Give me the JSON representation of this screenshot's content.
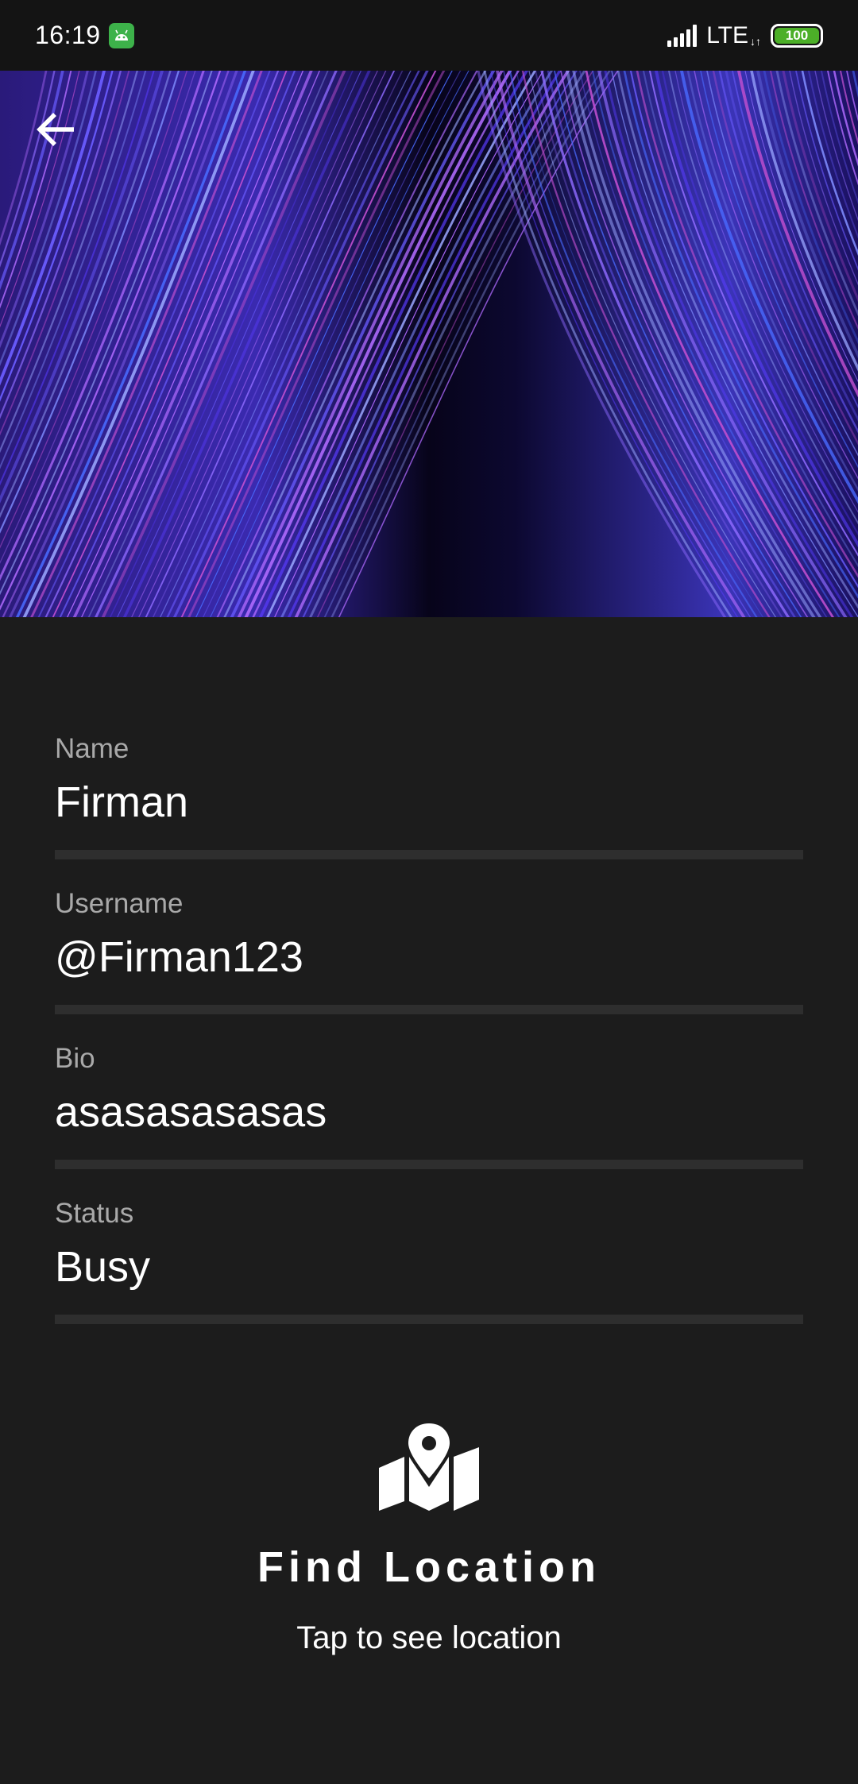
{
  "status_bar": {
    "time": "16:19",
    "network": "LTE",
    "battery": "100",
    "battery_color": "#4caf28",
    "app_icon": "android-robot-icon"
  },
  "header": {
    "back_icon": "arrow-left-icon",
    "banner_image": "purple-blue-light-streaks"
  },
  "profile": {
    "fields": [
      {
        "label": "Name",
        "value": "Firman"
      },
      {
        "label": "Username",
        "value": "@Firman123"
      },
      {
        "label": "Bio",
        "value": "asasasasasas"
      },
      {
        "label": "Status",
        "value": "Busy"
      }
    ]
  },
  "find_location": {
    "icon": "map-marker-icon",
    "title": "Find Location",
    "subtitle": "Tap to see location"
  },
  "colors": {
    "background": "#1c1c1c",
    "status_bar": "#141414",
    "label": "#a9a9a9",
    "divider": "#2e2e2e"
  }
}
